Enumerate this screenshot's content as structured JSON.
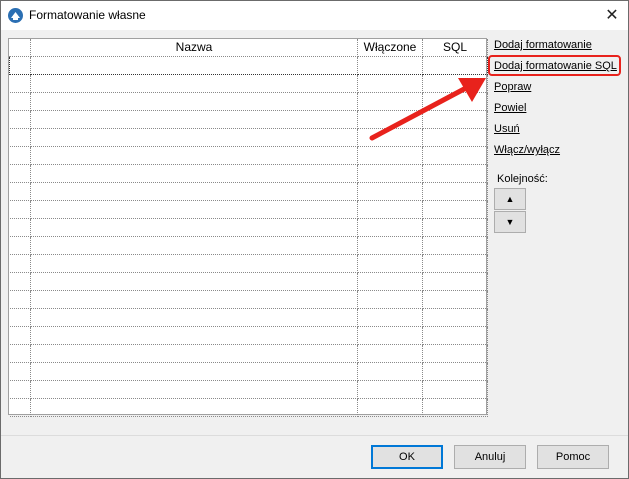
{
  "window": {
    "title": "Formatowanie własne",
    "close_label": "✕"
  },
  "grid": {
    "columns": [
      "",
      "Nazwa",
      "Włączone",
      "SQL"
    ],
    "row_count": 20
  },
  "actions": {
    "add": "Dodaj formatowanie",
    "add_sql": "Dodaj formatowanie SQL",
    "edit": "Popraw",
    "duplicate": "Powiel",
    "delete": "Usuń",
    "toggle": "Włącz/wyłącz"
  },
  "order": {
    "label": "Kolejność:",
    "up_icon": "▲",
    "down_icon": "▼"
  },
  "buttons": {
    "ok": "OK",
    "cancel": "Anuluj",
    "help": "Pomoc"
  },
  "colors": {
    "highlight": "#e8221c",
    "annotation_arrow": "#e8221c"
  }
}
